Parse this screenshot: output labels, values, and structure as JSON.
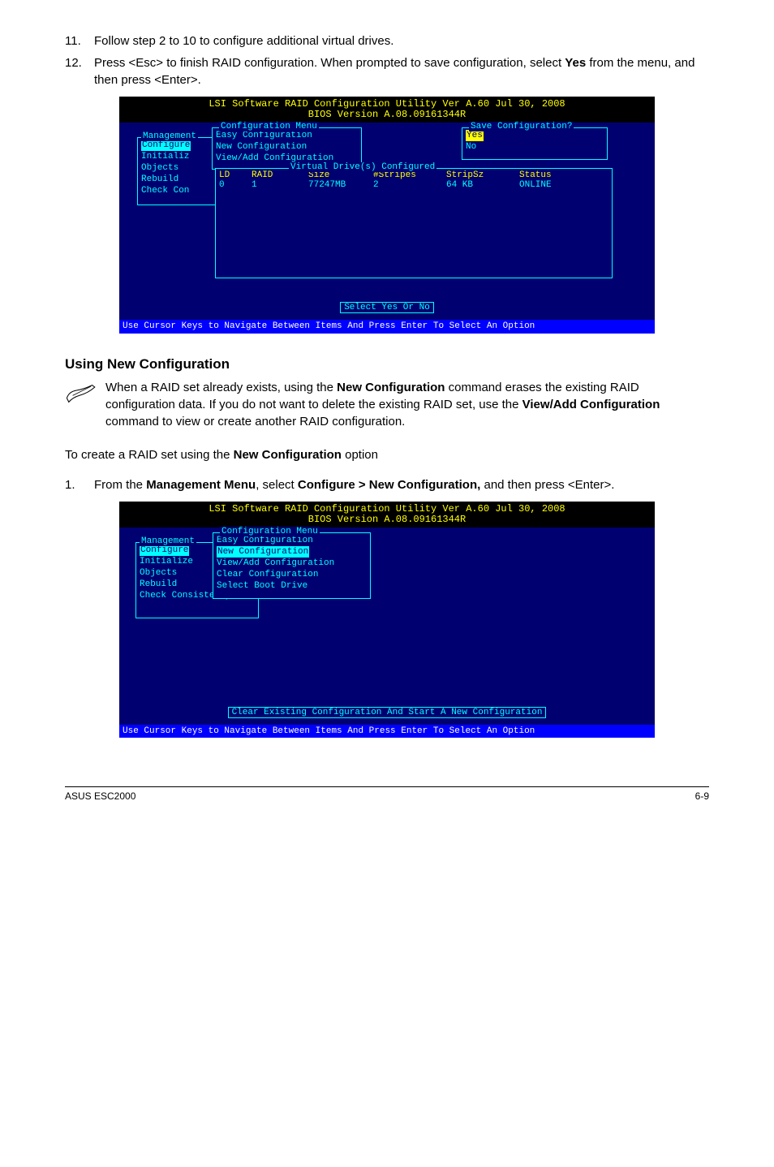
{
  "steps_top": [
    {
      "num": "11.",
      "text_plain": "Follow step 2 to 10 to configure additional virtual drives."
    },
    {
      "num": "12.",
      "text_html": "Press <Esc> to finish RAID configuration. When prompted to save configuration, select <b>Yes</b> from the menu, and then press <Enter>."
    }
  ],
  "bios1": {
    "header_line1": "LSI Software RAID Configuration Utility Ver A.60 Jul 30, 2008",
    "header_line2": "BIOS Version  A.08.09161344R",
    "mgmt_title": "Management",
    "mgmt_items": [
      "Configure",
      "Initializ",
      "Objects",
      "Rebuild",
      "Check Con"
    ],
    "mgmt_selected": "Configure",
    "conf_title": "Configuration Menu",
    "conf_items": [
      "Easy Configuration",
      "New Configuration",
      "View/Add Configuration"
    ],
    "save_title": "Save Configuration?",
    "save_items": [
      "Yes",
      "No"
    ],
    "save_selected": "Yes",
    "vd_title": "Virtual Drive(s) Configured",
    "vd_headers": {
      "ld": "LD",
      "raid": "RAID",
      "size": "Size",
      "stripes": "#Stripes",
      "stripsz": "StripSz",
      "status": "Status"
    },
    "vd_row": {
      "ld": "0",
      "raid": "1",
      "size": "77247MB",
      "stripes": "2",
      "stripsz": "64 KB",
      "status": "ONLINE"
    },
    "prompt": "Select Yes Or No",
    "footer": "Use Cursor Keys to Navigate Between Items And Press Enter To Select An Option"
  },
  "section_title": "Using New Configuration",
  "note_html": "When a RAID set already exists, using the <b>New Configuration</b> command erases the existing RAID configuration data. If you do not want to delete the existing RAID set, use the <b>View/Add Configuration</b> command to view or create another RAID configuration.",
  "body_line_html": "To create a RAID set using the <b>New Configuration</b> option",
  "steps_bottom": [
    {
      "num": "1.",
      "text_html": "From the <b>Management Menu</b>, select <b>Configure > New Configuration,</b> and then press <Enter>."
    }
  ],
  "bios2": {
    "header_line1": "LSI Software RAID Configuration Utility Ver A.60 Jul 30, 2008",
    "header_line2": "BIOS Version  A.08.09161344R",
    "mgmt_title": "Management",
    "mgmt_items": [
      "Configure",
      "Initialize",
      "Objects",
      "Rebuild",
      "Check Consistency"
    ],
    "mgmt_selected": "Configure",
    "conf_title": "Configuration Menu",
    "conf_items": [
      "Easy Configuration",
      "New Configuration",
      "View/Add Configuration",
      "Clear Configuration",
      "Select Boot Drive"
    ],
    "conf_selected": "New Configuration",
    "prompt": "Clear Existing Configuration And Start A New Configuration",
    "footer": "Use Cursor Keys to Navigate Between Items And Press Enter To Select An Option"
  },
  "footer_left": "ASUS ESC2000",
  "footer_right": "6-9"
}
